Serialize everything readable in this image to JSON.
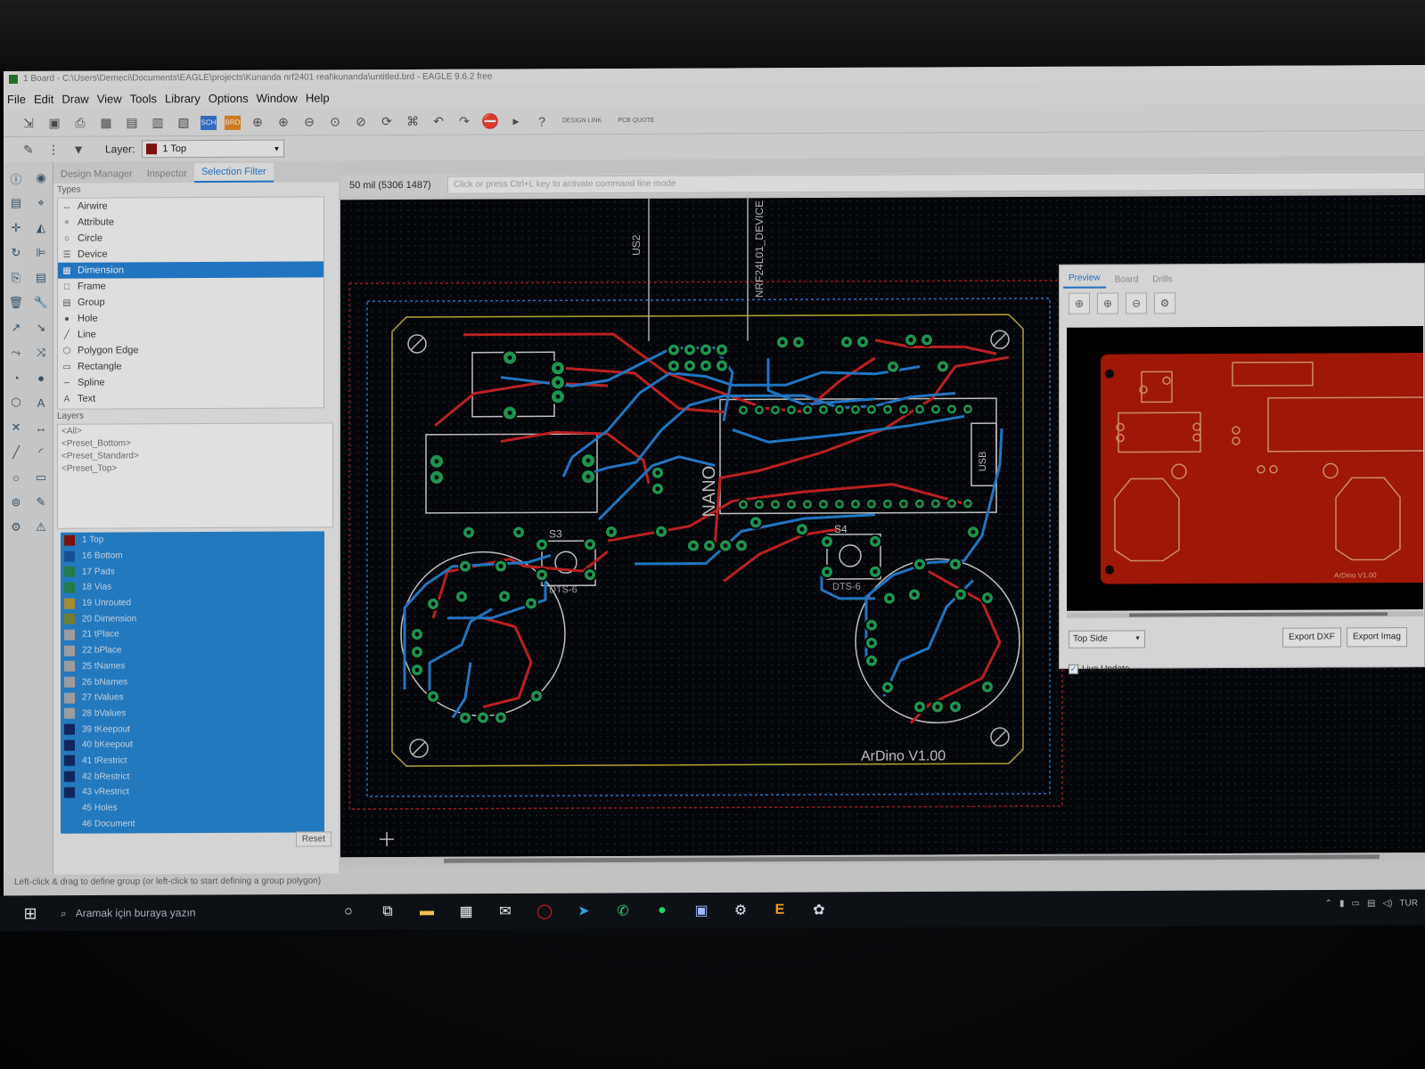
{
  "window": {
    "title": "1 Board - C:\\Users\\Demeci\\Documents\\EAGLE\\projects\\Kunanda nrf2401 real\\kunanda\\untitled.brd - EAGLE 9.6.2 free"
  },
  "menu": [
    "File",
    "Edit",
    "Draw",
    "View",
    "Tools",
    "Library",
    "Options",
    "Window",
    "Help"
  ],
  "toolbar": {
    "design_link": "DESIGN LINK",
    "pcb_quote": "PCB QUOTE",
    "help": "?"
  },
  "layer_bar": {
    "label": "Layer:",
    "value": "1 Top",
    "color": "#8b1a1a"
  },
  "panel": {
    "tabs": [
      "Design Manager",
      "Inspector",
      "Selection Filter"
    ],
    "active_tab": "Selection Filter",
    "types_header": "Types",
    "types": [
      {
        "label": "Airwire",
        "icon": "↔"
      },
      {
        "label": "Attribute",
        "icon": "⚬"
      },
      {
        "label": "Circle",
        "icon": "○"
      },
      {
        "label": "Device",
        "icon": "☰"
      },
      {
        "label": "Dimension",
        "icon": "▦"
      },
      {
        "label": "Frame",
        "icon": "□"
      },
      {
        "label": "Group",
        "icon": "▤"
      },
      {
        "label": "Hole",
        "icon": "●"
      },
      {
        "label": "Line",
        "icon": "╱"
      },
      {
        "label": "Polygon Edge",
        "icon": "⬡"
      },
      {
        "label": "Rectangle",
        "icon": "▭"
      },
      {
        "label": "Spline",
        "icon": "∽"
      },
      {
        "label": "Text",
        "icon": "A"
      }
    ],
    "selected_type": "Dimension",
    "layers_header": "Layers",
    "presets": [
      "<All>",
      "<Preset_Bottom>",
      "<Preset_Standard>",
      "<Preset_Top>"
    ],
    "layers": [
      {
        "label": "1 Top",
        "color": "#8b1a1a"
      },
      {
        "label": "16 Bottom",
        "color": "#1f5fa8"
      },
      {
        "label": "17 Pads",
        "color": "#2e8b57"
      },
      {
        "label": "18 Vias",
        "color": "#2e8b57"
      },
      {
        "label": "19 Unrouted",
        "color": "#b8a040"
      },
      {
        "label": "20 Dimension",
        "color": "#7f8f3a"
      },
      {
        "label": "21 tPlace",
        "color": "#b0b0b0"
      },
      {
        "label": "22 bPlace",
        "color": "#b0b0b0"
      },
      {
        "label": "25 tNames",
        "color": "#b0b0b0"
      },
      {
        "label": "26 bNames",
        "color": "#b0b0b0"
      },
      {
        "label": "27 tValues",
        "color": "#b0b0b0"
      },
      {
        "label": "28 bValues",
        "color": "#b0b0b0"
      },
      {
        "label": "39 tKeepout",
        "color": "#1a2f6b"
      },
      {
        "label": "40 bKeepout",
        "color": "#1a2f6b"
      },
      {
        "label": "41 tRestrict",
        "color": "#1a2f6b"
      },
      {
        "label": "42 bRestrict",
        "color": "#1a2f6b"
      },
      {
        "label": "43 vRestrict",
        "color": "#1a2f6b"
      },
      {
        "label": "45 Holes",
        "color": "#2d8ad4"
      },
      {
        "label": "46 Document",
        "color": "#2d8ad4"
      }
    ],
    "reset": "Reset"
  },
  "info": {
    "coordinate": "50 mil (5306 1487)",
    "command_placeholder": "Click or press Ctrl+L key to activate command line mode"
  },
  "board": {
    "labels": {
      "us2": "US2",
      "nrf": "NRF24L01_DEVICE",
      "nano": "NANO",
      "usb": "USB",
      "s3": "S3",
      "s4": "S4",
      "dts_left": "DTS-6",
      "dts_right": "DTS-6",
      "title": "ArDino V1.00"
    },
    "colors": {
      "top": "#d12a2a",
      "bottom": "#2a86d8",
      "pad": "#27a85a",
      "outline": "#d6d6d6",
      "dim": "#c8b83a"
    }
  },
  "preview": {
    "tabs": [
      "Preview",
      "Board",
      "Drills"
    ],
    "active_tab": "Preview",
    "side": "Top Side",
    "export_dxf": "Export DXF",
    "export_image": "Export Imag",
    "live_update": "Live Update",
    "board_text": "ArDino V1.00",
    "color": "#b2200f"
  },
  "status": "Left-click & drag to define group (or left-click to start defining a group polygon)",
  "taskbar": {
    "search": "Aramak için buraya yazın",
    "tray": "TUR"
  }
}
